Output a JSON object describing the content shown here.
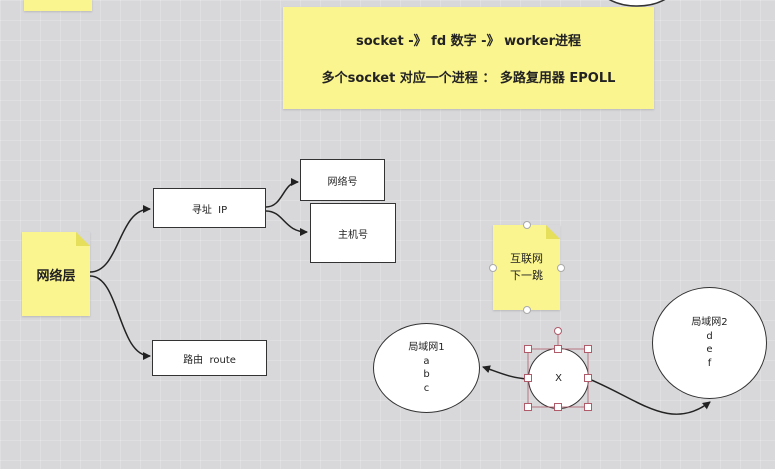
{
  "title_note": {
    "line1": "socket -》 fd 数字 -》 worker进程",
    "line2": "多个socket 对应一个进程 ： 多路复用器 EPOLL"
  },
  "network_layer": {
    "label": "网络层"
  },
  "addressing": {
    "label": "寻址  IP"
  },
  "network_number": {
    "label": "网络号"
  },
  "host_number": {
    "label": "主机号"
  },
  "routing": {
    "label": "路由  route"
  },
  "internet_note": {
    "line1": "互联网",
    "line2": "下一跳"
  },
  "lan1": {
    "title": "局域网1",
    "lines": [
      "a",
      "b",
      "c"
    ]
  },
  "lan2": {
    "title": "局域网2",
    "lines": [
      "d",
      "e",
      "f"
    ]
  },
  "node_x": {
    "label": "X"
  },
  "colors": {
    "note": "#fbf58f",
    "canvas": "#d8d8db",
    "selection": "#b05a6a"
  }
}
